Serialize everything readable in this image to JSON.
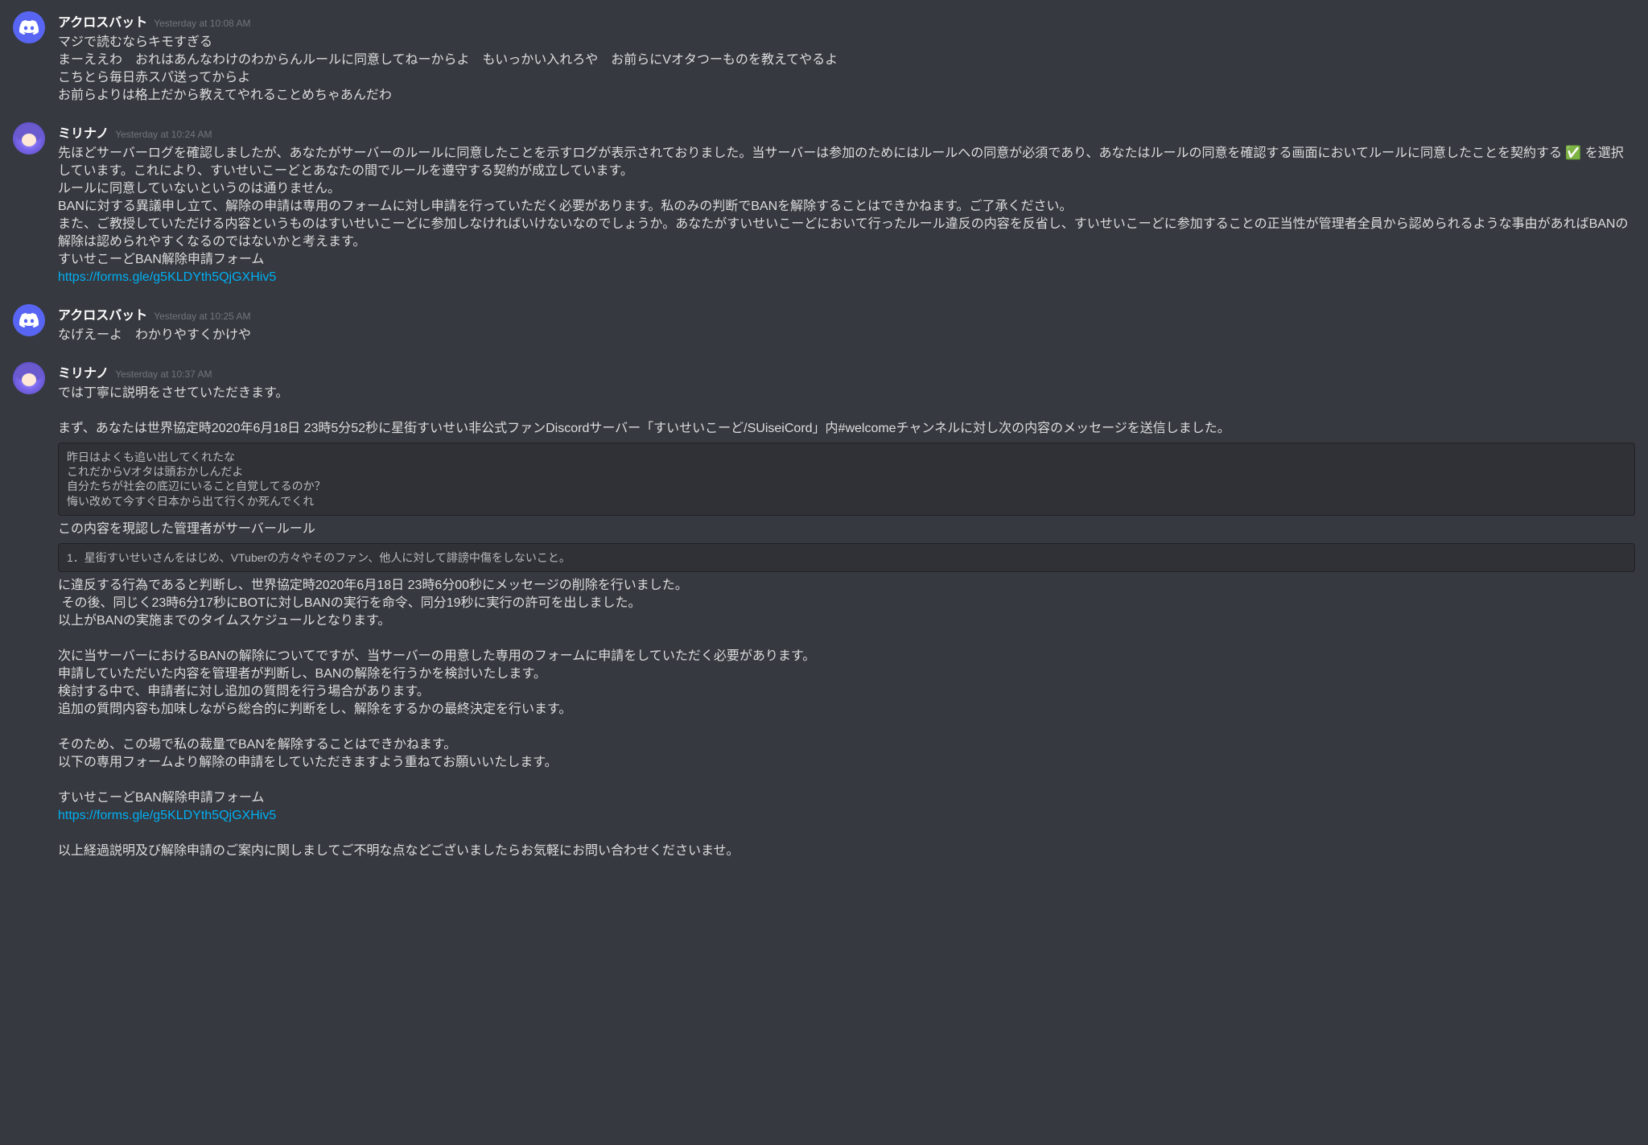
{
  "messages": [
    {
      "avatar": "discord",
      "username": "アクロスバット",
      "timestamp": "Yesterday at 10:08 AM",
      "lines": [
        {
          "t": "text",
          "v": "マジで読むならキモすぎる"
        },
        {
          "t": "text",
          "v": "まーええわ　おれはあんなわけのわからんルールに同意してねーからよ　もいっかい入れろや　お前らにVオタつーものを教えてやるよ"
        },
        {
          "t": "text",
          "v": "こちとら毎日赤スパ送ってからよ"
        },
        {
          "t": "text",
          "v": "お前らよりは格上だから教えてやれることめちゃあんだわ"
        }
      ]
    },
    {
      "avatar": "user2",
      "username": "ミリナノ",
      "timestamp": "Yesterday at 10:24 AM",
      "lines": [
        {
          "t": "text",
          "v": "先ほどサーバーログを確認しましたが、あなたがサーバーのルールに同意したことを示すログが表示されておりました。当サーバーは参加のためにはルールへの同意が必須であり、あなたはルールの同意を確認する画面においてルールに同意したことを契約する ✅ を選択しています。これにより、すいせいこーどとあなたの間でルールを遵守する契約が成立しています。"
        },
        {
          "t": "text",
          "v": "ルールに同意していないというのは通りません。"
        },
        {
          "t": "text",
          "v": "BANに対する異議申し立て、解除の申請は専用のフォームに対し申請を行っていただく必要があります。私のみの判断でBANを解除することはできかねます。ご了承ください。"
        },
        {
          "t": "text",
          "v": "また、ご教授していただける内容というものはすいせいこーどに参加しなければいけないなのでしょうか。あなたがすいせいこーどにおいて行ったルール違反の内容を反省し、すいせいこーどに参加することの正当性が管理者全員から認められるような事由があればBANの解除は認められやすくなるのではないかと考えます。"
        },
        {
          "t": "text",
          "v": "すいせこーどBAN解除申請フォーム"
        },
        {
          "t": "link",
          "v": "https://forms.gle/g5KLDYth5QjGXHiv5"
        }
      ]
    },
    {
      "avatar": "discord",
      "username": "アクロスバット",
      "timestamp": "Yesterday at 10:25 AM",
      "lines": [
        {
          "t": "text",
          "v": "なげえーよ　わかりやすくかけや"
        }
      ]
    },
    {
      "avatar": "user2",
      "username": "ミリナノ",
      "timestamp": "Yesterday at 10:37 AM",
      "lines": [
        {
          "t": "text",
          "v": "では丁寧に説明をさせていただきます。"
        },
        {
          "t": "blank"
        },
        {
          "t": "text",
          "v": "まず、あなたは世界協定時2020年6月18日 23時5分52秒に星街すいせい非公式ファンDiscordサーバー「すいせいこーど/SUiseiCord」内#welcomeチャンネルに対し次の内容のメッセージを送信しました。"
        },
        {
          "t": "code",
          "v": "昨日はよくも追い出してくれたな\nこれだからVオタは頭おかしんだよ\n自分たちが社会の底辺にいること自覚してるのか？\n悔い改めて今すぐ日本から出て行くか死んでくれ"
        },
        {
          "t": "text",
          "v": "この内容を現認した管理者がサーバールール"
        },
        {
          "t": "code",
          "v": "1．星街すいせいさんをはじめ、VTuberの方々やそのファン、他人に対して誹謗中傷をしないこと。"
        },
        {
          "t": "text",
          "v": "に違反する行為であると判断し、世界協定時2020年6月18日 23時6分00秒にメッセージの削除を行いました。"
        },
        {
          "t": "text",
          "v": " その後、同じく23時6分17秒にBOTに対しBANの実行を命令、同分19秒に実行の許可を出しました。"
        },
        {
          "t": "text",
          "v": "以上がBANの実施までのタイムスケジュールとなります。"
        },
        {
          "t": "blank"
        },
        {
          "t": "text",
          "v": "次に当サーバーにおけるBANの解除についてですが、当サーバーの用意した専用のフォームに申請をしていただく必要があります。"
        },
        {
          "t": "text",
          "v": "申請していただいた内容を管理者が判断し、BANの解除を行うかを検討いたします。"
        },
        {
          "t": "text",
          "v": "検討する中で、申請者に対し追加の質問を行う場合があります。"
        },
        {
          "t": "text",
          "v": "追加の質問内容も加味しながら総合的に判断をし、解除をするかの最終決定を行います。"
        },
        {
          "t": "blank"
        },
        {
          "t": "text",
          "v": "そのため、この場で私の裁量でBANを解除することはできかねます。"
        },
        {
          "t": "text",
          "v": "以下の専用フォームより解除の申請をしていただきますよう重ねてお願いいたします。"
        },
        {
          "t": "blank"
        },
        {
          "t": "text",
          "v": "すいせこーどBAN解除申請フォーム"
        },
        {
          "t": "link",
          "v": "https://forms.gle/g5KLDYth5QjGXHiv5"
        },
        {
          "t": "blank"
        },
        {
          "t": "text",
          "v": "以上経過説明及び解除申請のご案内に関しましてご不明な点などございましたらお気軽にお問い合わせくださいませ。"
        }
      ]
    }
  ]
}
